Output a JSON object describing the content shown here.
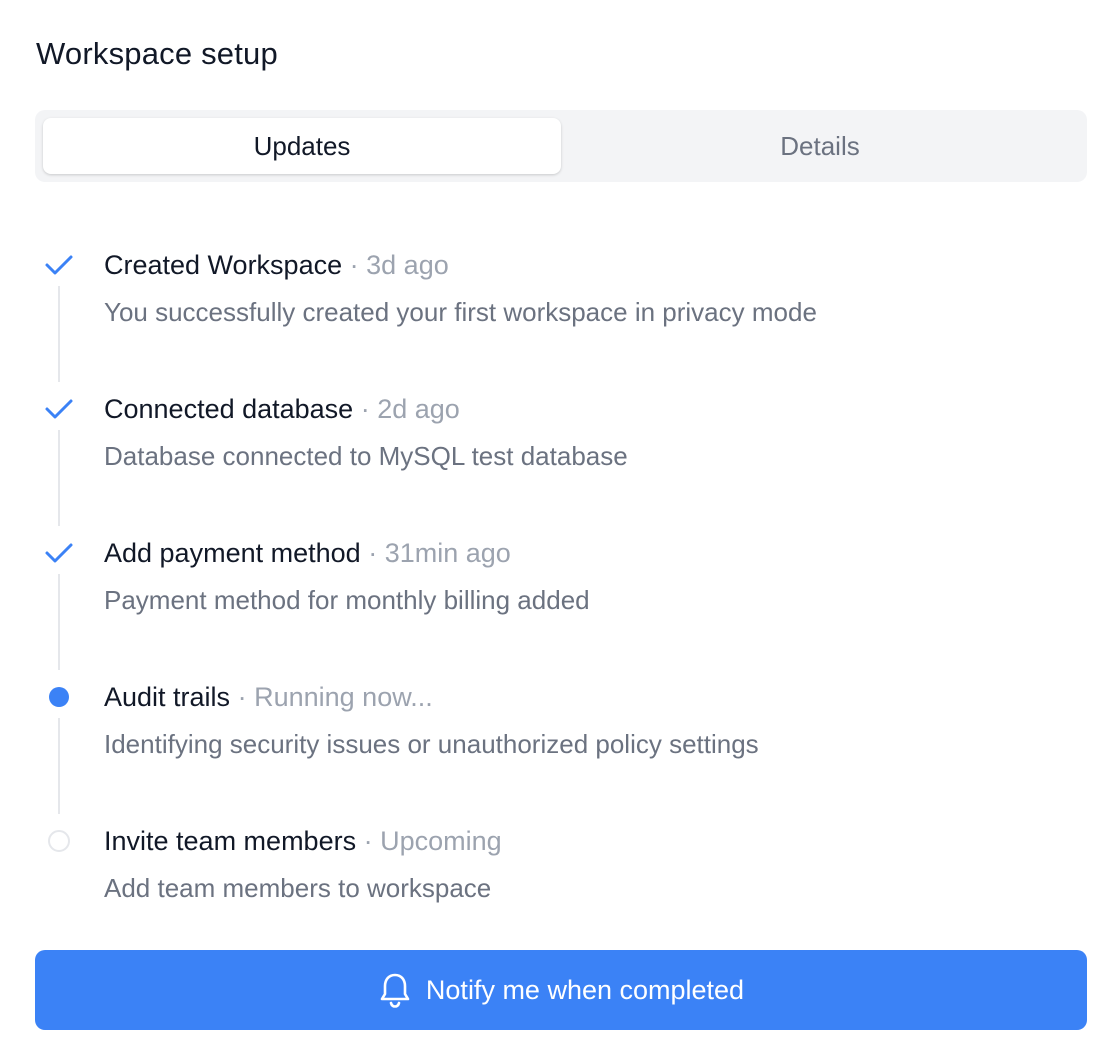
{
  "page": {
    "title": "Workspace setup"
  },
  "tabs": [
    {
      "label": "Updates",
      "selected": true
    },
    {
      "label": "Details",
      "selected": false
    }
  ],
  "steps": [
    {
      "title": "Created Workspace",
      "separator": "·",
      "time": "3d ago",
      "description": "You successfully created your first workspace in privacy mode",
      "status": "completed",
      "icon": "check-icon"
    },
    {
      "title": "Connected database",
      "separator": "·",
      "time": "2d ago",
      "description": "Database connected to MySQL test database",
      "status": "completed",
      "icon": "check-icon"
    },
    {
      "title": "Add payment method",
      "separator": "·",
      "time": "31min ago",
      "description": "Payment method for monthly billing added",
      "status": "completed",
      "icon": "check-icon"
    },
    {
      "title": "Audit trails",
      "separator": "·",
      "time": "Running now...",
      "description": "Identifying security issues or unauthorized policy settings",
      "status": "in-progress",
      "icon": "active-dot-icon"
    },
    {
      "title": "Invite team members",
      "separator": "·",
      "time": "Upcoming",
      "description": "Add team members to workspace",
      "status": "upcoming",
      "icon": "empty-circle-icon"
    }
  ],
  "notify_button": {
    "label": "Notify me when completed",
    "icon": "bell-icon"
  },
  "colors": {
    "accent": "#3b82f6",
    "text_primary": "#111827",
    "text_secondary": "#6b7280",
    "text_muted": "#9ca3af",
    "tab_background": "#f3f4f6",
    "connector": "#e5e7eb"
  }
}
